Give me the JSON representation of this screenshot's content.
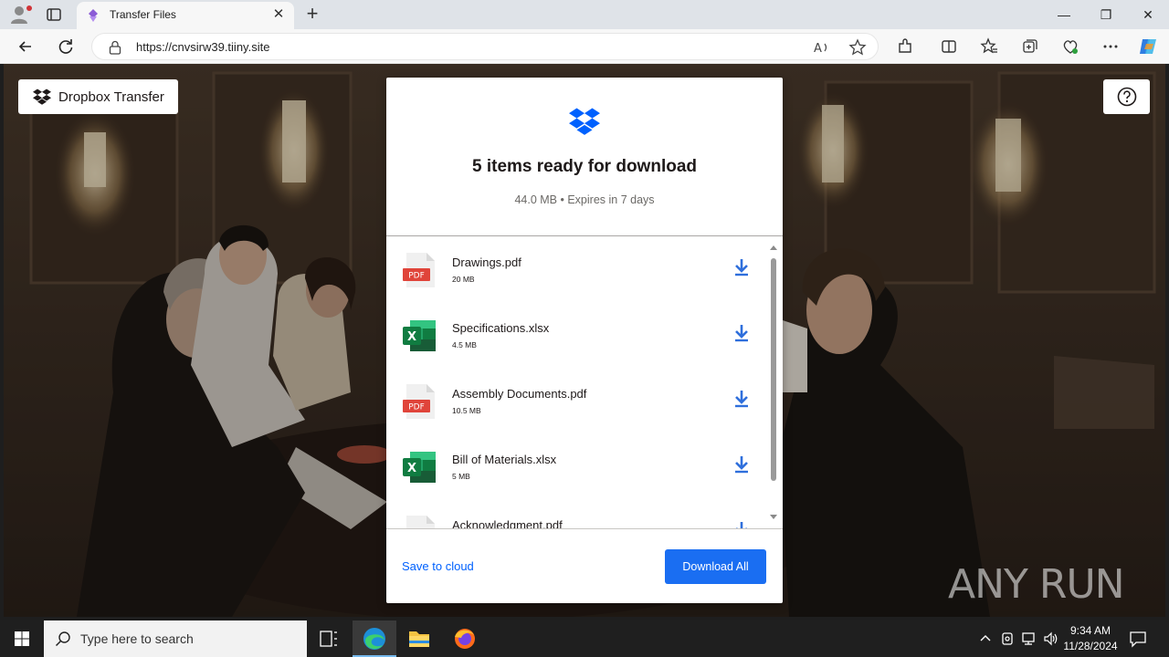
{
  "browser": {
    "tab_title": "Transfer Files",
    "url": "https://cnvsirw39.tiiny.site",
    "window_controls": {
      "minimize": "—",
      "restore": "❐",
      "close": "✕"
    },
    "toolbar_icons": [
      "back-icon",
      "refresh-icon",
      "read-aloud-icon",
      "favorite-star-icon",
      "extensions-icon",
      "split-screen-icon",
      "favorites-icon",
      "collections-icon",
      "browser-essentials-icon",
      "more-icon",
      "copilot-icon"
    ]
  },
  "page": {
    "brand_label": "Dropbox Transfer",
    "help_icon": "question-circle-icon",
    "modal": {
      "title": "5 items ready for download",
      "subtitle": "44.0 MB • Expires in 7 days",
      "files": [
        {
          "name": "Drawings.pdf",
          "size": "20 MB",
          "type": "pdf"
        },
        {
          "name": "Specifications.xlsx",
          "size": "4.5 MB",
          "type": "xlsx"
        },
        {
          "name": "Assembly Documents.pdf",
          "size": "10.5 MB",
          "type": "pdf"
        },
        {
          "name": "Bill of Materials.xlsx",
          "size": "5 MB",
          "type": "xlsx"
        },
        {
          "name": "Acknowledgment.pdf",
          "size": "",
          "type": "pdf"
        }
      ],
      "pdf_badge": "PDF",
      "xlsx_badge": "X",
      "save_link": "Save to cloud",
      "download_all": "Download All"
    },
    "watermark": "ANY RUN"
  },
  "taskbar": {
    "search_placeholder": "Type here to search",
    "time": "9:34 AM",
    "date": "11/28/2024"
  },
  "colors": {
    "dropbox_blue": "#0061fe",
    "button_blue": "#1a6ef2",
    "pdf_red": "#e0443a",
    "excel_green": "#1d7044"
  }
}
